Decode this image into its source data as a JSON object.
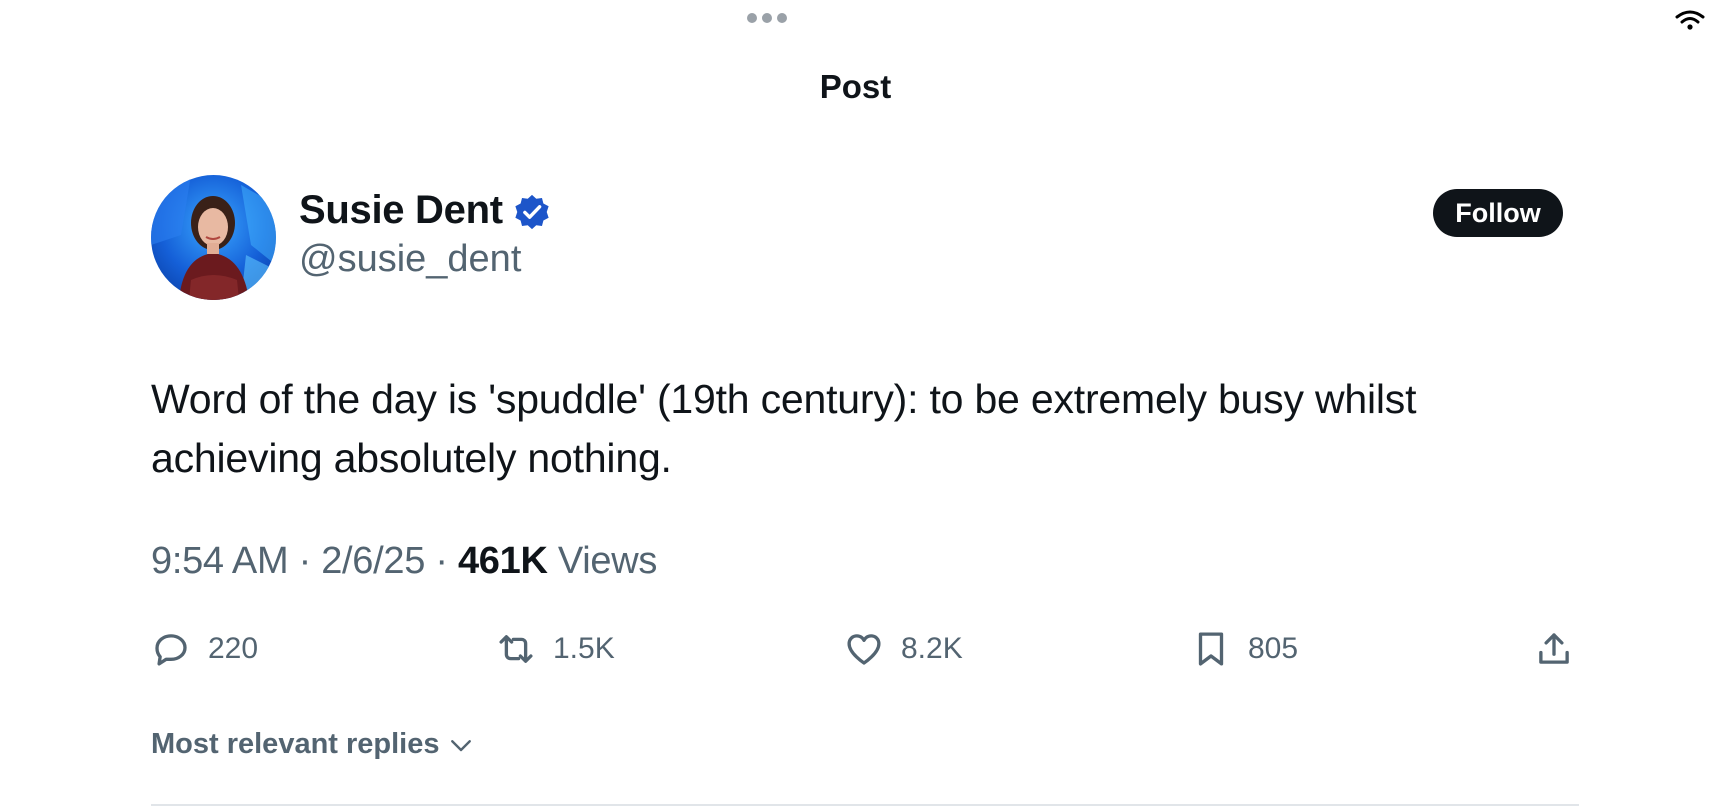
{
  "header": {
    "title": "Post"
  },
  "author": {
    "name": "Susie Dent",
    "handle": "@susie_dent",
    "verified_color": "#1d55c9",
    "follow_label": "Follow"
  },
  "tweet": {
    "text": "Word of the day is 'spuddle' (19th century): to be extremely busy whilst achieving absolutely nothing.",
    "time": "9:54 AM",
    "date": "2/6/25",
    "separator": "·",
    "views_count": "461K",
    "views_label": "Views"
  },
  "actions": {
    "reply": {
      "icon": "reply-icon",
      "count": "220"
    },
    "retweet": {
      "icon": "retweet-icon",
      "count": "1.5K"
    },
    "like": {
      "icon": "heart-icon",
      "count": "8.2K"
    },
    "bookmark": {
      "icon": "bookmark-icon",
      "count": "805"
    },
    "share": {
      "icon": "share-icon"
    }
  },
  "replies": {
    "sort_label": "Most relevant replies"
  },
  "colors": {
    "text_primary": "#0f1419",
    "text_secondary": "#536471",
    "follow_bg": "#0f1419",
    "divider": "#e1e5e9"
  }
}
